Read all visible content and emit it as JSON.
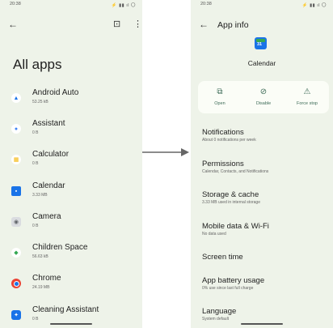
{
  "left": {
    "status": {
      "time": "20:38",
      "icons": "⚡ ▮▮ ıl 〇"
    },
    "title": "All apps",
    "apps": [
      {
        "name": "Android Auto",
        "size": "53.25 kB",
        "color": "#1a73e8",
        "glyph": "▲"
      },
      {
        "name": "Assistant",
        "size": "0 B",
        "color": "#4285f4",
        "glyph": "●"
      },
      {
        "name": "Calculator",
        "size": "0 B",
        "color": "#f4b400",
        "glyph": "+"
      },
      {
        "name": "Calendar",
        "size": "3.33 MB",
        "color": "#1a73e8",
        "glyph": "▪"
      },
      {
        "name": "Camera",
        "size": "0 B",
        "color": "#9aa0a6",
        "glyph": "◉"
      },
      {
        "name": "Children Space",
        "size": "56.63 kB",
        "color": "#34a853",
        "glyph": "◆"
      },
      {
        "name": "Chrome",
        "size": "24.19 MB",
        "color": "#ea4335",
        "glyph": "●"
      },
      {
        "name": "Cleaning Assistant",
        "size": "0 B",
        "color": "#1a73e8",
        "glyph": "✦"
      }
    ]
  },
  "right": {
    "status": {
      "time": "20:38",
      "icons": "⚡ ▮▮ ıl 〇"
    },
    "header": {
      "title": "App info"
    },
    "app": {
      "name": "Calendar"
    },
    "actions": [
      {
        "label": "Open",
        "icon": "↗"
      },
      {
        "label": "Disable",
        "icon": "⊘"
      },
      {
        "label": "Force stop",
        "icon": "⚠"
      }
    ],
    "settings": [
      {
        "title": "Notifications",
        "subtitle": "About 0 notifications per week"
      },
      {
        "title": "Permissions",
        "subtitle": "Calendar, Contacts, and Notifications"
      },
      {
        "title": "Storage & cache",
        "subtitle": "3.33 MB used in internal storage"
      },
      {
        "title": "Mobile data & Wi-Fi",
        "subtitle": "No data used"
      },
      {
        "title": "Screen time",
        "subtitle": ""
      },
      {
        "title": "App battery usage",
        "subtitle": "0% use since last full charge"
      },
      {
        "title": "Language",
        "subtitle": "System default"
      }
    ]
  }
}
